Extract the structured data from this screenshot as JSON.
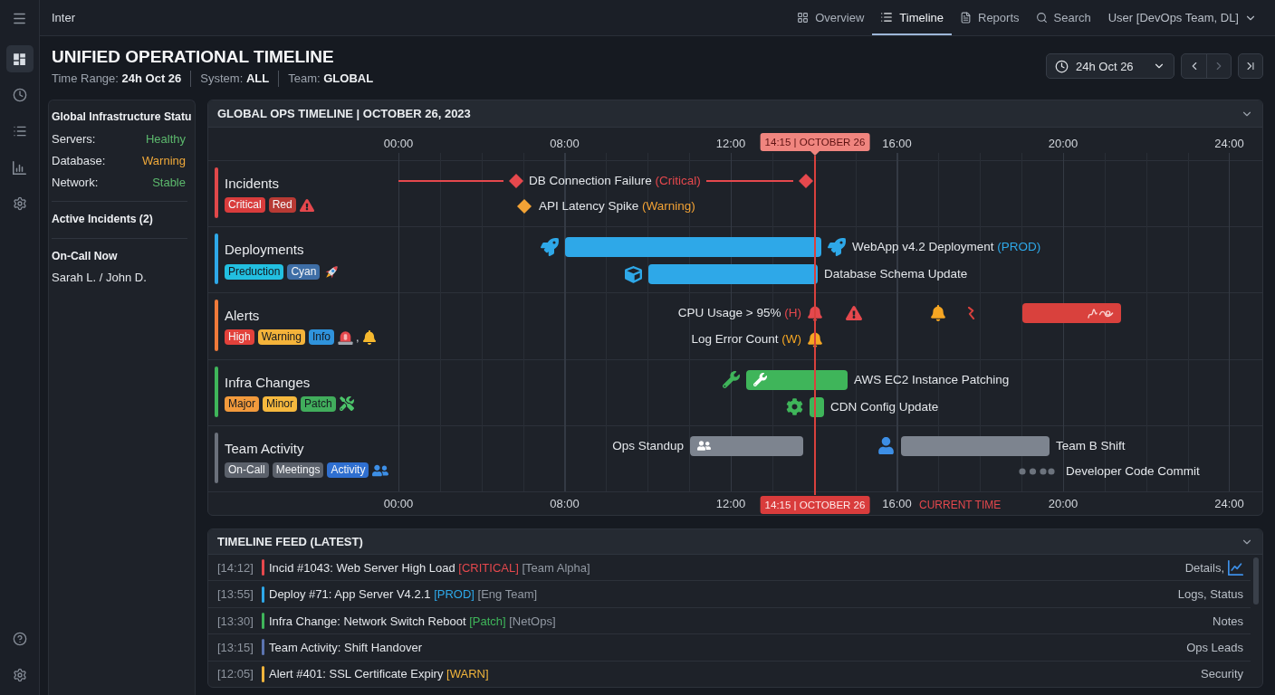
{
  "app": {
    "title": "Inter"
  },
  "rail": {
    "items": [
      {
        "selected": true
      },
      {
        "selected": false
      },
      {
        "selected": false
      },
      {
        "selected": false
      },
      {
        "selected": false
      }
    ]
  },
  "nav": {
    "tabs": [
      {
        "label": "Overview",
        "selected": false
      },
      {
        "label": "Timeline",
        "selected": true
      },
      {
        "label": "Reports",
        "selected": false
      },
      {
        "label": "Search",
        "selected": false
      }
    ],
    "user": "User [DevOps Team, DL]"
  },
  "header": {
    "title": "UNIFIED OPERATIONAL TIMELINE",
    "filters": [
      {
        "label": "Time Range:",
        "value": "24h Oct 26"
      },
      {
        "label": "System:",
        "value": "ALL"
      },
      {
        "label": "Team:",
        "value": "GLOBAL"
      }
    ],
    "range_select": "24h Oct 26",
    "pager": [
      {
        "kind": "prev",
        "disabled": false
      },
      {
        "kind": "next",
        "disabled": true
      },
      {
        "kind": "last",
        "disabled": false
      }
    ]
  },
  "sidebar": {
    "status_title": "Global Infrastructure Statu",
    "status": [
      {
        "label": "Servers:",
        "value": "Healthy",
        "color": "#5cb96d"
      },
      {
        "label": "Database:",
        "value": "Warning",
        "color": "#f0a93a"
      },
      {
        "label": "Network:",
        "value": "Stable",
        "color": "#5cb96d"
      }
    ],
    "incidents_title": "Active Incidents (2)",
    "on_call_title": "On-Call Now",
    "on_call": "Sarah L. / John D."
  },
  "timeline": {
    "title": "GLOBAL OPS TIMELINE | OCTOBER 26, 2023",
    "expanded": true,
    "top_axis": [
      "00:00",
      "08:00",
      "12:00",
      "16:00",
      "20:00",
      "24:00"
    ],
    "now_label_top": "14:15 | OCTOBER 26",
    "lanes": [
      {
        "title": "Incidents",
        "color": "#e0484a",
        "tags": [
          {
            "label": "Critical",
            "color": "#d93c3c"
          },
          {
            "label": "Red",
            "color": "#b83a34"
          }
        ],
        "events": [
          {
            "kind": "milestone",
            "label": "DB Connection Failure",
            "tag": "(Critical)",
            "color": "#e5484d"
          },
          {
            "kind": "point",
            "label": "API Latency Spike",
            "tag": "(Warning)",
            "color": "#f2a235"
          }
        ]
      },
      {
        "title": "Deployments",
        "color": "#2ea8e8",
        "tags": [
          {
            "label": "Preduction",
            "color": "#22bfe0"
          },
          {
            "label": "Cyan",
            "color": "#3e6ea6"
          }
        ],
        "events": [
          {
            "kind": "bar",
            "label": "WebApp v4.2 Deployment",
            "tag": "(PROD)",
            "color": "#2ea8e8"
          },
          {
            "kind": "bar",
            "label": "Database Schema Update",
            "color": "#2ea8e8"
          }
        ]
      },
      {
        "title": "Alerts",
        "color": "#f07a3a",
        "tags": [
          {
            "label": "High",
            "color": "#e2413b"
          },
          {
            "label": "Warning",
            "color": "#f4b33a"
          },
          {
            "label": "Info",
            "color": "#2f93dc"
          }
        ],
        "icon_separator": ",",
        "events": [
          {
            "kind": "alert",
            "label": "CPU Usage > 95%",
            "tag": "(H)",
            "color": "#e5484d"
          },
          {
            "kind": "alert",
            "label": "Log Error Count",
            "tag": "(W)",
            "color": "#f5a623"
          },
          {
            "kind": "marker",
            "color": "#e5484d"
          },
          {
            "kind": "marker",
            "color": "#f5a623"
          },
          {
            "kind": "marker",
            "color": "#d9413d"
          },
          {
            "kind": "bar",
            "color": "#d9413d"
          }
        ]
      },
      {
        "title": "Infra Changes",
        "color": "#3fb55a",
        "tags": [
          {
            "label": "Major",
            "color": "#f29a3c"
          },
          {
            "label": "Minor",
            "color": "#f5b83e"
          },
          {
            "label": "Patch",
            "color": "#41ad5c"
          }
        ],
        "events": [
          {
            "kind": "bar",
            "label": "AWS EC2 Instance Patching",
            "color": "#3fb55a"
          },
          {
            "kind": "bar",
            "label": "CDN Config Update",
            "color": "#3fb55a"
          }
        ]
      },
      {
        "title": "Team Activity",
        "color": "#6b717b",
        "tags": [
          {
            "label": "On-Call",
            "color": "#5b616b"
          },
          {
            "label": "Meetings",
            "color": "#5b616b"
          },
          {
            "label": "Activity",
            "color": "#2f6fd0"
          }
        ],
        "events": [
          {
            "kind": "bar",
            "label": "Ops Standup",
            "color": "#7d848f"
          },
          {
            "kind": "bar",
            "label": "Team B Shift",
            "color": "#7d848f"
          },
          {
            "kind": "dots",
            "label": "Developer Code Commit",
            "color": "#6c737d"
          }
        ]
      }
    ],
    "bottom_axis": [
      "00:00",
      "08:00",
      "12:00",
      "16:00",
      "20:00",
      "24:00"
    ],
    "now_label_bottom": "14:15 | OCTOBER 26",
    "current_time_label": "CURRENT TIME"
  },
  "feed": {
    "title": "TIMELINE FEED (LATEST)",
    "expanded": true,
    "rows": [
      {
        "time": "[14:12]",
        "text": "Incid #1043: Web Server High Load",
        "tag": "[CRITICAL]",
        "team": "[Team Alpha]",
        "color": "#e5484d",
        "actions": "Details,",
        "has_chart": true
      },
      {
        "time": "[13:55]",
        "text": "Deploy #71: App Server V4.2.1",
        "tag": "[PROD]",
        "team": "[Eng Team]",
        "color": "#2ea8e8",
        "actions": "Logs, Status",
        "has_chart": false
      },
      {
        "time": "[13:30]",
        "text": "Infra Change: Network Switch Reboot",
        "tag": "[Patch]",
        "team": "[NetOps]",
        "color": "#3fb55a",
        "actions": "Notes",
        "has_chart": false
      },
      {
        "time": "[13:15]",
        "text": "Team Activity: Shift Handover",
        "color": "#5b74b0",
        "actions": "Ops Leads",
        "has_chart": false
      },
      {
        "time": "[12:05]",
        "text": "Alert #401: SSL Certificate Expiry",
        "tag": "[WARN]",
        "color": "#f0b43c",
        "actions": "Security",
        "has_chart": false
      }
    ]
  }
}
